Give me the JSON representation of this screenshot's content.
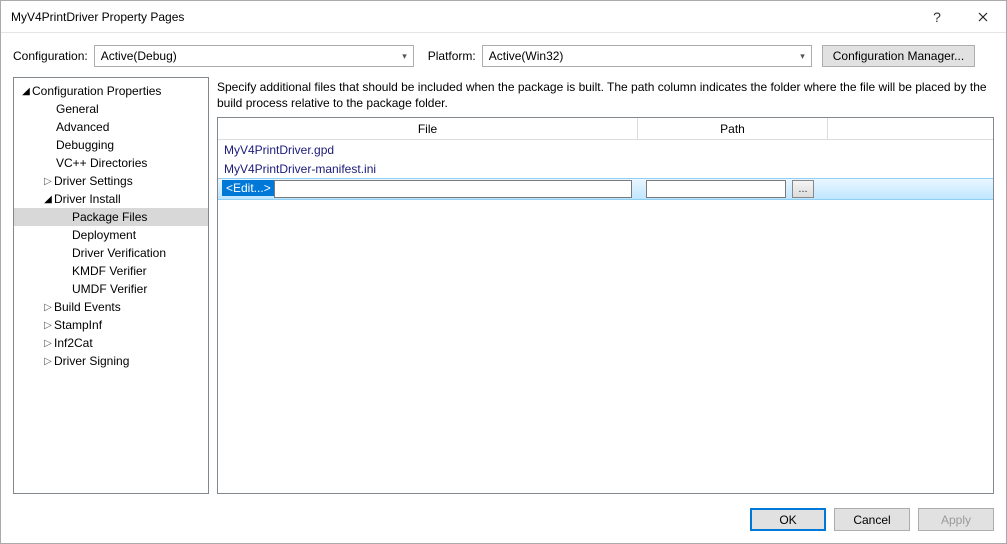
{
  "window": {
    "title": "MyV4PrintDriver Property Pages"
  },
  "topbar": {
    "configuration_label": "Configuration:",
    "configuration_value": "Active(Debug)",
    "platform_label": "Platform:",
    "platform_value": "Active(Win32)",
    "config_manager_label": "Configuration Manager..."
  },
  "tree": {
    "root": "Configuration Properties",
    "items": {
      "general": "General",
      "advanced": "Advanced",
      "debugging": "Debugging",
      "vcppdirs": "VC++ Directories",
      "driver_settings": "Driver Settings",
      "driver_install": "Driver Install",
      "package_files": "Package Files",
      "deployment": "Deployment",
      "driver_verification": "Driver Verification",
      "kmdf_verifier": "KMDF Verifier",
      "umdf_verifier": "UMDF Verifier",
      "build_events": "Build Events",
      "stampinf": "StampInf",
      "inf2cat": "Inf2Cat",
      "driver_signing": "Driver Signing"
    }
  },
  "panel": {
    "description": "Specify additional files that should be included when the package is built.  The path column indicates the folder where the file will be placed by the build process relative to the package folder.",
    "columns": {
      "file": "File",
      "path": "Path"
    },
    "rows": [
      {
        "file": "MyV4PrintDriver.gpd",
        "path": ""
      },
      {
        "file": "MyV4PrintDriver-manifest.ini",
        "path": ""
      }
    ],
    "edit_placeholder": "<Edit...>",
    "browse_label": "..."
  },
  "footer": {
    "ok": "OK",
    "cancel": "Cancel",
    "apply": "Apply"
  }
}
